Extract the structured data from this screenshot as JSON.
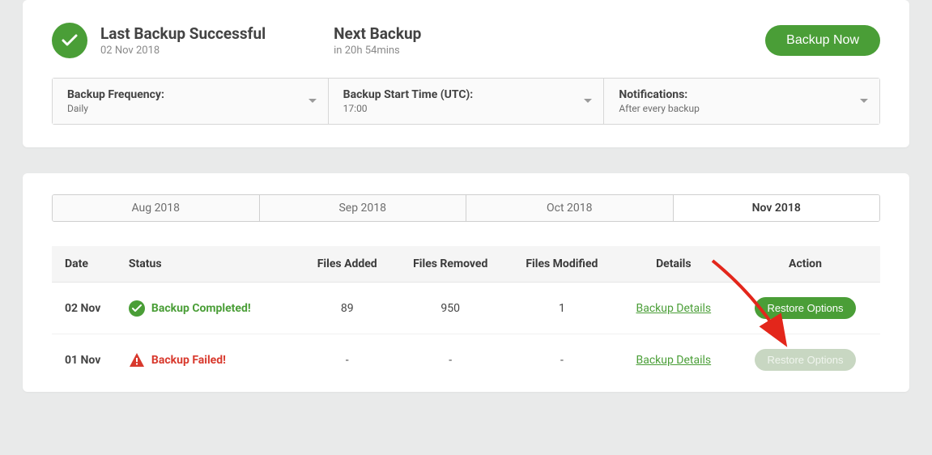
{
  "summary": {
    "lastTitle": "Last Backup Successful",
    "lastDate": "02 Nov 2018",
    "nextTitle": "Next Backup",
    "nextIn": "in 20h 54mins",
    "button": "Backup Now"
  },
  "settings": {
    "frequencyLabel": "Backup Frequency:",
    "frequencyValue": "Daily",
    "startTimeLabel": "Backup Start Time (UTC):",
    "startTimeValue": "17:00",
    "notificationsLabel": "Notifications:",
    "notificationsValue": "After every backup"
  },
  "tabs": [
    "Aug 2018",
    "Sep 2018",
    "Oct 2018",
    "Nov 2018"
  ],
  "tabsActiveIndex": 3,
  "columns": {
    "date": "Date",
    "status": "Status",
    "added": "Files Added",
    "removed": "Files Removed",
    "modified": "Files Modified",
    "details": "Details",
    "action": "Action"
  },
  "rows": [
    {
      "date": "02 Nov",
      "statusText": "Backup Completed!",
      "statusKind": "ok",
      "added": "89",
      "removed": "950",
      "modified": "1",
      "details": "Backup Details",
      "action": "Restore Options",
      "actionEnabled": true
    },
    {
      "date": "01 Nov",
      "statusText": "Backup Failed!",
      "statusKind": "fail",
      "added": "-",
      "removed": "-",
      "modified": "-",
      "details": "Backup Details",
      "action": "Restore Options",
      "actionEnabled": false
    }
  ]
}
